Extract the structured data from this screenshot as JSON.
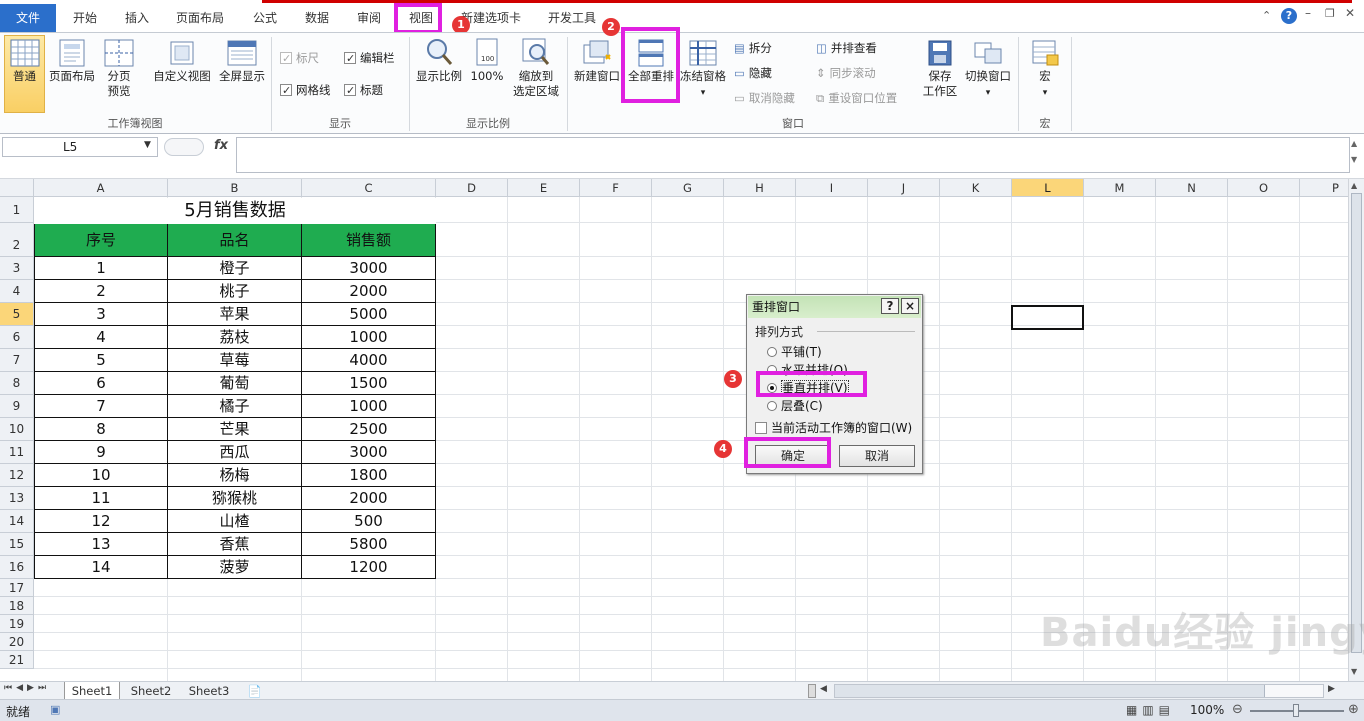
{
  "menubar": {
    "file_tab": "文件",
    "tabs": [
      "开始",
      "插入",
      "页面布局",
      "公式",
      "数据",
      "审阅",
      "视图",
      "新建选项卡",
      "开发工具"
    ]
  },
  "ribbon": {
    "workbook_views": {
      "label": "工作簿视图",
      "normal": "普通",
      "page_layout": "页面布局",
      "page_break_line1": "分页",
      "page_break_line2": "预览",
      "custom_views": "自定义视图",
      "full_screen": "全屏显示"
    },
    "show": {
      "label": "显示",
      "ruler": "标尺",
      "formula_bar": "编辑栏",
      "gridlines": "网格线",
      "headings": "标题"
    },
    "zoom": {
      "label": "显示比例",
      "zoom": "显示比例",
      "hundred": "100%",
      "zoom_sel_line1": "缩放到",
      "zoom_sel_line2": "选定区域"
    },
    "window": {
      "label": "窗口",
      "new_window": "新建窗口",
      "arrange_all": "全部重排",
      "freeze_panes": "冻结窗格",
      "split": "拆分",
      "hide": "隐藏",
      "unhide": "取消隐藏",
      "side_by_side": "并排查看",
      "sync_scroll": "同步滚动",
      "reset_pos": "重设窗口位置",
      "save_ws_line1": "保存",
      "save_ws_line2": "工作区",
      "switch_windows": "切换窗口"
    },
    "macros": {
      "label": "宏",
      "macros": "宏"
    }
  },
  "badges": [
    "1",
    "2",
    "3",
    "4"
  ],
  "formula_bar": {
    "name_box": "L5",
    "fx": "fx"
  },
  "grid": {
    "columns": [
      "A",
      "B",
      "C",
      "D",
      "E",
      "F",
      "G",
      "H",
      "I",
      "J",
      "K",
      "L",
      "M",
      "N",
      "O",
      "P"
    ],
    "rows": [
      "1",
      "2",
      "3",
      "4",
      "5",
      "6",
      "7",
      "8",
      "9",
      "10",
      "11",
      "12",
      "13",
      "14",
      "15",
      "16",
      "17",
      "18",
      "19",
      "20",
      "21"
    ],
    "title": "5月销售数据",
    "headers": [
      "序号",
      "品名",
      "销售额"
    ],
    "data": [
      [
        "1",
        "橙子",
        "3000"
      ],
      [
        "2",
        "桃子",
        "2000"
      ],
      [
        "3",
        "苹果",
        "5000"
      ],
      [
        "4",
        "荔枝",
        "1000"
      ],
      [
        "5",
        "草莓",
        "4000"
      ],
      [
        "6",
        "葡萄",
        "1500"
      ],
      [
        "7",
        "橘子",
        "1000"
      ],
      [
        "8",
        "芒果",
        "2500"
      ],
      [
        "9",
        "西瓜",
        "3000"
      ],
      [
        "10",
        "杨梅",
        "1800"
      ],
      [
        "11",
        "猕猴桃",
        "2000"
      ],
      [
        "12",
        "山楂",
        "500"
      ],
      [
        "13",
        "香蕉",
        "5800"
      ],
      [
        "14",
        "菠萝",
        "1200"
      ]
    ]
  },
  "dialog": {
    "title": "重排窗口",
    "help": "?",
    "close": "×",
    "section": "排列方式",
    "opt_tiled": "平铺(T)",
    "opt_horizontal": "水平并排(O)",
    "opt_vertical": "垂直并排(V)",
    "opt_cascade": "层叠(C)",
    "active_only": "当前活动工作簿的窗口(W)",
    "ok": "确定",
    "cancel": "取消"
  },
  "sheets": [
    "Sheet1",
    "Sheet2",
    "Sheet3"
  ],
  "status": {
    "ready": "就绪",
    "zoom": "100%"
  },
  "watermark": "Baidu经验 jingyan.baidu.com",
  "colors": {
    "header_green": "#1fac50",
    "highlight": "#e020e0",
    "badge": "#e63535",
    "file_tab": "#2b6fcb"
  }
}
